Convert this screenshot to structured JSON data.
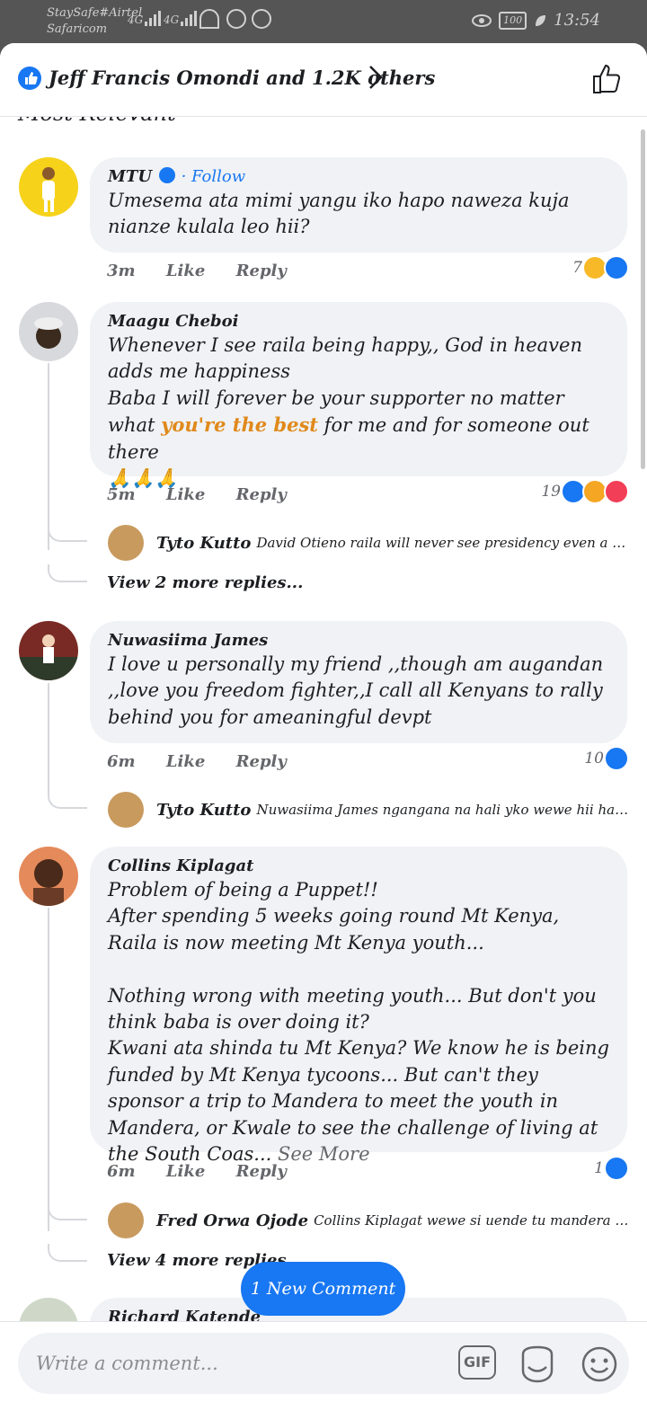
{
  "status_bar": {
    "carrier_line1": "StaySafe#Airtel",
    "carrier_line2": "Safaricom",
    "network1": "4G",
    "network2": "4G",
    "battery": "100",
    "time": "13:54"
  },
  "header": {
    "title": "Jeff Francis Omondi and 1.2K others",
    "clipped_label": "Most Relevant"
  },
  "comments": [
    {
      "author": "MTU",
      "verified": true,
      "follow": "Follow",
      "text": "Umesema ata mimi yangu iko hapo naweza kuja nianze kulala leo hii?",
      "time": "3m",
      "like": "Like",
      "reply": "Reply",
      "reaction_count": "7"
    },
    {
      "author": "Maagu Cheboi",
      "text_a": "Whenever I see raila being happy,, God in heaven adds me happiness\nBaba I will forever be your supporter no matter what ",
      "text_highlight": "you're the best",
      "text_b": " for me and for someone out there\n🙏🙏🙏",
      "time": "5m",
      "like": "Like",
      "reply": "Reply",
      "reaction_count": "19",
      "reply_preview": {
        "author": "Tyto Kutto",
        "text": "David Otieno  raila will never see presidency even a sing..."
      },
      "more_replies": "View 2 more replies..."
    },
    {
      "author": "Nuwasiima James",
      "text": "I love u personally my friend ,,though am augandan ,,love you freedom fighter,,I call all Kenyans to rally behind you for ameaningful devpt",
      "time": "6m",
      "like": "Like",
      "reply": "Reply",
      "reaction_count": "10",
      "reply_preview": {
        "author": "Tyto Kutto",
        "text": "Nuwasiima James  ngangana na hali yko wewe hii haikuuzu"
      }
    },
    {
      "author": "Collins Kiplagat",
      "text": "Problem of being a Puppet!!\nAfter spending 5 weeks going round Mt Kenya, Raila is now meeting Mt Kenya youth...\n\nNothing wrong with meeting youth... But don't you think baba is over doing it?\nKwani ata shinda tu Mt Kenya? We know he is being funded by Mt Kenya tycoons... But can't they sponsor a trip to Mandera to meet the youth in Mandera, or Kwale to see the challenge of living at the South Coas... ",
      "see_more": "See More",
      "time": "6m",
      "like": "Like",
      "reply": "Reply",
      "reaction_count": "1",
      "reply_preview": {
        "author": "Fred Orwa Ojode",
        "text": "Collins Kiplagat wewe si uende tu mandera huwac..."
      },
      "more_replies": "View 4 more replies..."
    },
    {
      "author": "Richard Katende"
    }
  ],
  "new_comment_pill": "1 New Comment",
  "composer": {
    "placeholder": "Write a comment...",
    "gif_label": "GIF"
  },
  "colors": {
    "accent": "#1877f2",
    "bubble": "#f0f2f5",
    "highlight": "#e0891b"
  }
}
